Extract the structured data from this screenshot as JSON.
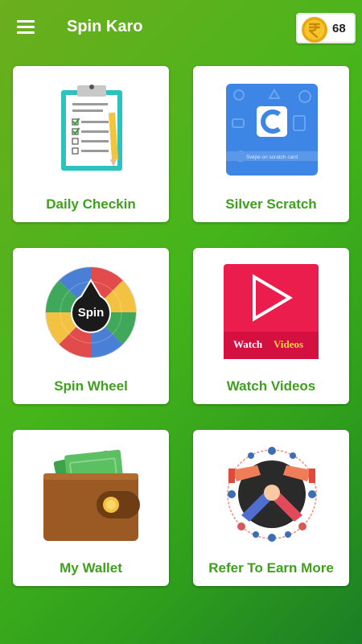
{
  "app": {
    "title": "Spin Karo",
    "coins": "68"
  },
  "cards": [
    {
      "label": "Daily Checkin",
      "icon": "clipboard-checklist-icon"
    },
    {
      "label": "Silver Scratch",
      "icon": "scratch-card-icon",
      "caption": "Swipe on scratch card"
    },
    {
      "label": "Spin Wheel",
      "icon": "spin-wheel-icon",
      "wheel_text": "Spin"
    },
    {
      "label": "Watch Videos",
      "icon": "play-video-icon",
      "banner_word1": "Watch",
      "banner_word2": "Videos"
    },
    {
      "label": "My Wallet",
      "icon": "wallet-icon"
    },
    {
      "label": "Refer To Earn More",
      "icon": "refer-handshake-icon"
    }
  ],
  "colors": {
    "accent": "#3fa01d",
    "header_green": "#45b51b"
  }
}
